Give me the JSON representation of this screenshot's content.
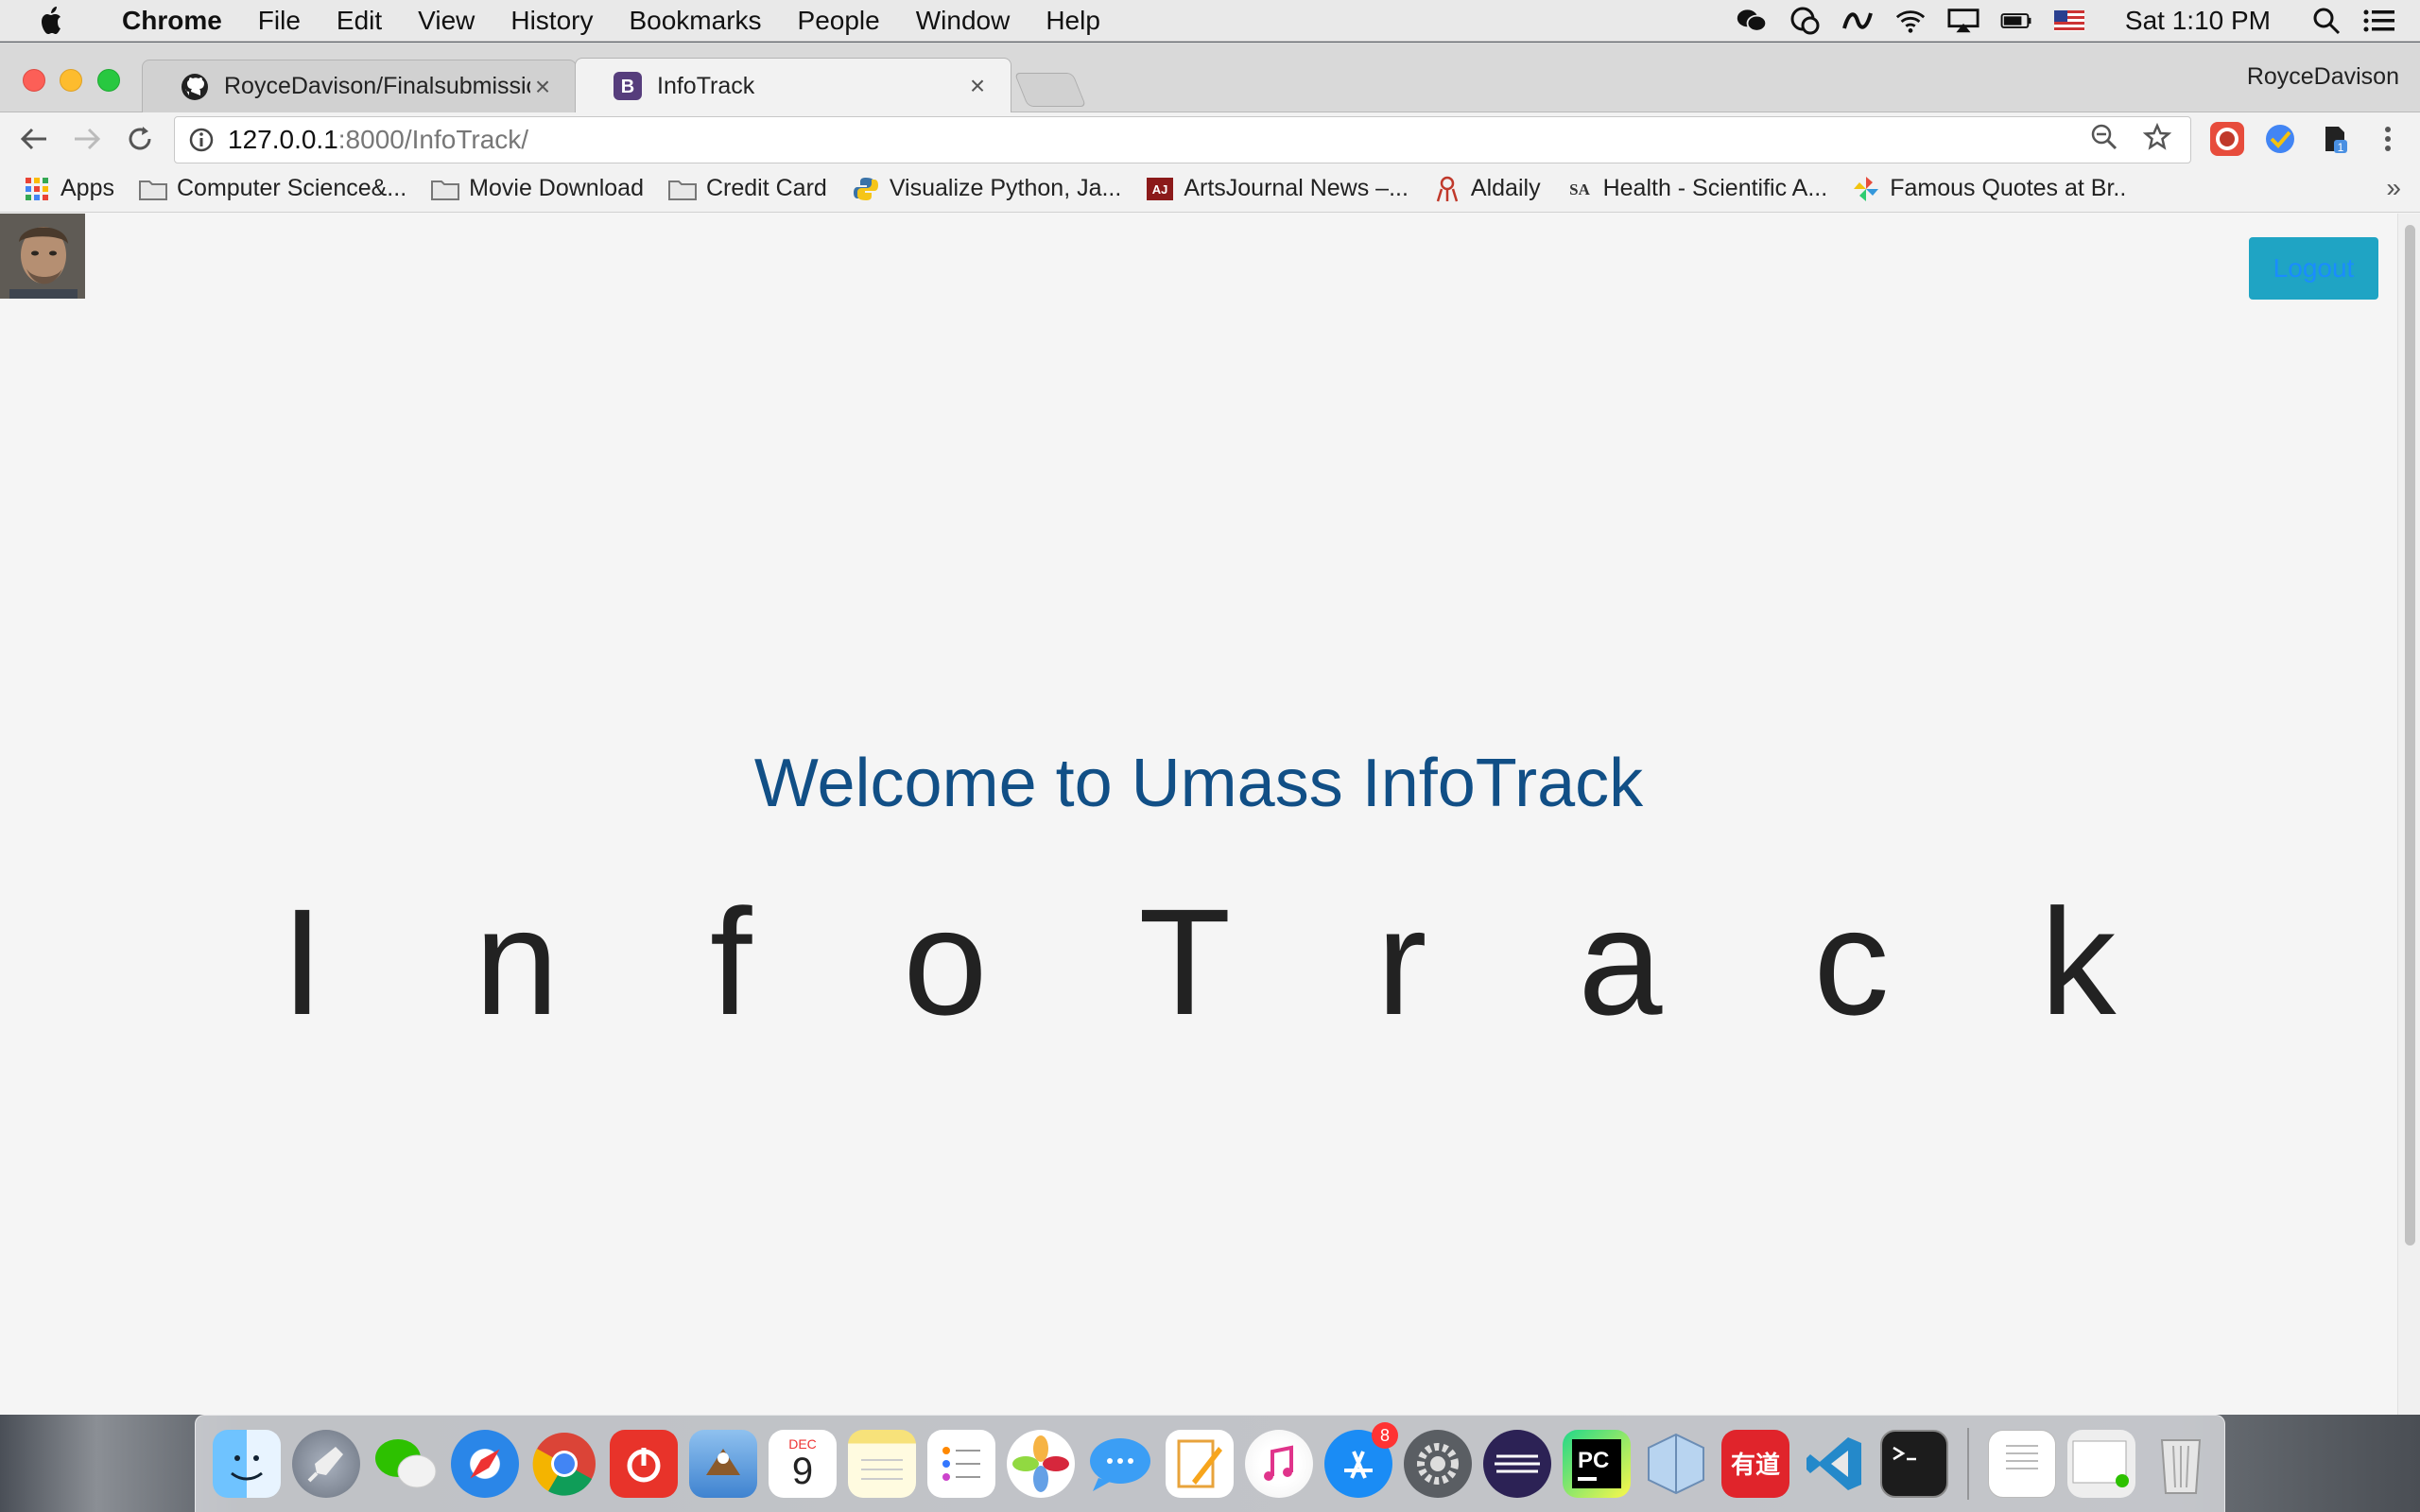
{
  "menubar": {
    "app_name": "Chrome",
    "menus": [
      "File",
      "Edit",
      "View",
      "History",
      "Bookmarks",
      "People",
      "Window",
      "Help"
    ],
    "clock": "Sat 1:10 PM",
    "status_icons": [
      "wechat-icon",
      "messages-icon",
      "creative-cloud-icon",
      "wifi-icon",
      "airplay-icon",
      "battery-icon",
      "us-flag-icon",
      "spotlight-icon",
      "notification-center-icon"
    ]
  },
  "browser": {
    "profile_name": "RoyceDavison",
    "tabs": [
      {
        "title": "RoyceDavison/Finalsubmission",
        "favicon": "github-icon",
        "active": false
      },
      {
        "title": "InfoTrack",
        "favicon": "bootstrap-icon",
        "active": true
      }
    ],
    "url_host": "127.0.0.1",
    "url_path": ":8000/InfoTrack/",
    "bookmarks": [
      {
        "label": "Apps",
        "icon": "apps-grid-icon"
      },
      {
        "label": "Computer Science&...",
        "icon": "folder-icon"
      },
      {
        "label": "Movie Download",
        "icon": "folder-icon"
      },
      {
        "label": "Credit Card",
        "icon": "folder-icon"
      },
      {
        "label": "Visualize Python, Ja...",
        "icon": "python-icon"
      },
      {
        "label": "ArtsJournal News –...",
        "icon": "artsjournal-icon"
      },
      {
        "label": "Aldaily",
        "icon": "aldaily-icon"
      },
      {
        "label": "Health - Scientific A...",
        "icon": "scientific-american-icon"
      },
      {
        "label": "Famous Quotes at Br..",
        "icon": "pinwheel-icon"
      }
    ]
  },
  "page": {
    "logout_label": "Logout",
    "welcome": "Welcome to Umass InfoTrack",
    "brand": "InfoTrack"
  },
  "dock": {
    "apps": [
      "finder",
      "launchpad",
      "wechat",
      "safari",
      "chrome",
      "netease-music",
      "mail",
      "calendar",
      "notes",
      "reminders",
      "photos",
      "messages",
      "pages",
      "itunes",
      "app-store",
      "system-preferences",
      "eclipse",
      "pycharm",
      "virtualbox",
      "youdao",
      "vscode",
      "terminal"
    ],
    "calendar_month": "DEC",
    "calendar_day": "9",
    "app_store_badge": "8"
  },
  "colors": {
    "welcome_text": "#114f86",
    "logout_bg": "#1fa4c4",
    "logout_text": "#1a8cff",
    "page_bg": "#f5f5f5"
  }
}
